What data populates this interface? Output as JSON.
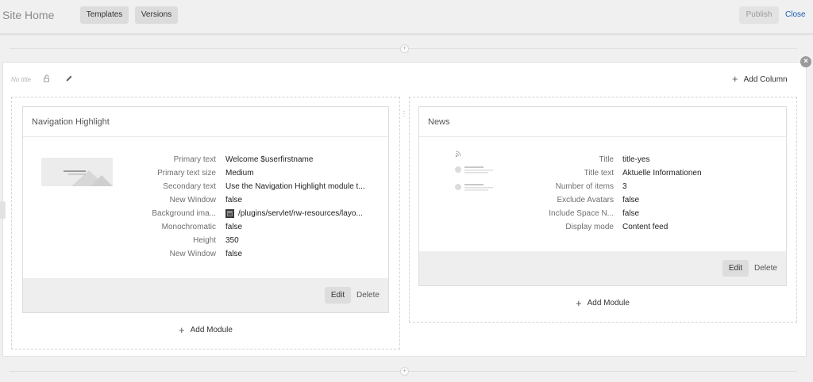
{
  "header": {
    "site_title": "Site Home",
    "templates_label": "Templates",
    "versions_label": "Versions",
    "publish_label": "Publish",
    "close_label": "Close"
  },
  "section": {
    "title_placeholder": "No title",
    "add_column_label": "Add Column",
    "close_symbol": "×"
  },
  "modules": [
    {
      "title": "Navigation Highlight",
      "properties": [
        {
          "label": "Primary text",
          "value": "Welcome $userfirstname"
        },
        {
          "label": "Primary text size",
          "value": "Medium"
        },
        {
          "label": "Secondary text",
          "value": "Use the Navigation Highlight module t..."
        },
        {
          "label": "New Window",
          "value": "false"
        },
        {
          "label": "Background ima...",
          "value": "/plugins/servlet/rw-resources/layo..."
        },
        {
          "label": "Monochromatic",
          "value": "false"
        },
        {
          "label": "Height",
          "value": "350"
        },
        {
          "label": "New Window",
          "value": "false"
        }
      ],
      "edit_label": "Edit",
      "delete_label": "Delete",
      "add_module_label": "Add Module"
    },
    {
      "title": "News",
      "properties": [
        {
          "label": "Title",
          "value": "title-yes"
        },
        {
          "label": "Title text",
          "value": "Aktuelle Informationen"
        },
        {
          "label": "Number of items",
          "value": "3"
        },
        {
          "label": "Exclude Avatars",
          "value": "false"
        },
        {
          "label": "Include Space N...",
          "value": "false"
        },
        {
          "label": "Display mode",
          "value": "Content feed"
        }
      ],
      "edit_label": "Edit",
      "delete_label": "Delete",
      "add_module_label": "Add Module"
    }
  ],
  "icons": {
    "plus": "+",
    "lock": "lock-icon",
    "pencil": "pencil-icon",
    "rss": "rss-icon",
    "image": "image-icon"
  },
  "colors": {
    "link": "#1a5fb4",
    "panel_bg": "#ffffff",
    "page_bg": "#f0f0f0",
    "footer_bg": "#eeeeee"
  }
}
